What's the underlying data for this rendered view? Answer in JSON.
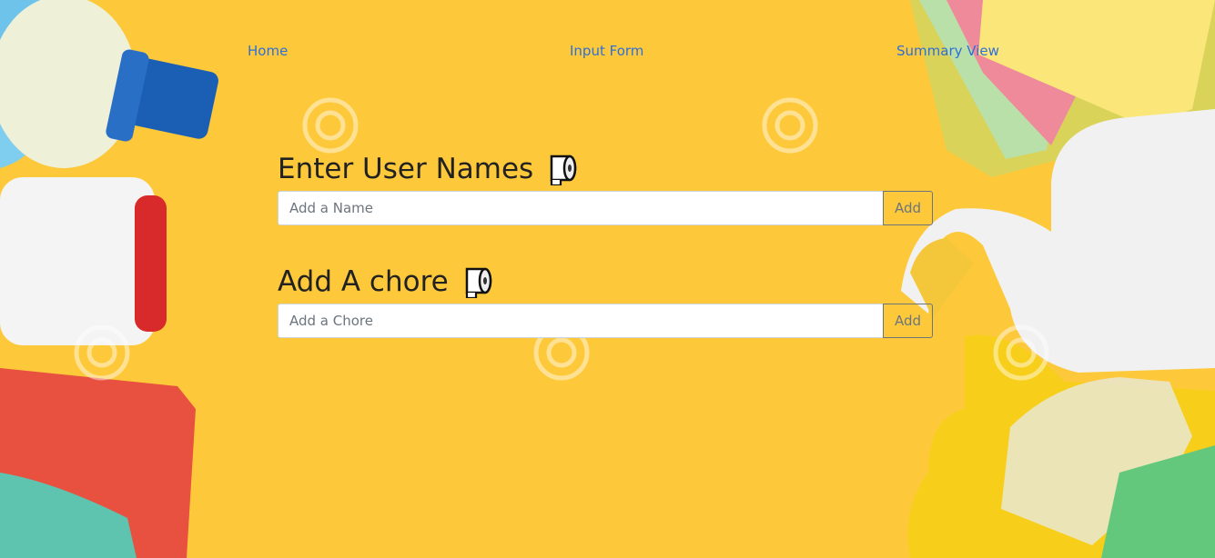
{
  "nav": {
    "home": "Home",
    "input_form": "Input Form",
    "summary_view": "Summary View"
  },
  "users": {
    "title": "Enter User Names",
    "placeholder": "Add a Name",
    "button": "Add",
    "icon": "toilet-paper-icon"
  },
  "chores": {
    "title": "Add A chore",
    "placeholder": "Add a Chore",
    "button": "Add",
    "icon": "toilet-paper-icon"
  },
  "colors": {
    "background": "#fdc93b",
    "link": "#2f6fd6",
    "button_border": "#6c757d"
  }
}
